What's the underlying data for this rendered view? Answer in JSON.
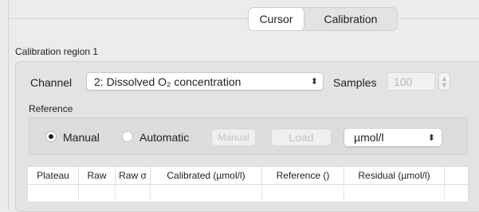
{
  "tabs": [
    {
      "label": "Cursor",
      "selected": true
    },
    {
      "label": "Calibration",
      "selected": false
    }
  ],
  "region": {
    "title": "Calibration region 1"
  },
  "channel": {
    "label": "Channel",
    "value": "2: Dissolved O₂ concentration"
  },
  "samples": {
    "label": "Samples",
    "value": "100"
  },
  "reference": {
    "title": "Reference",
    "modes": [
      {
        "label": "Manual",
        "checked": true
      },
      {
        "label": "Automatic",
        "checked": false
      }
    ],
    "manual_button": "Manual",
    "load_button": "Load",
    "unit": "µmol/l"
  },
  "table": {
    "columns": [
      "Plateau",
      "Raw",
      "Raw σ",
      "Calibrated (µmol/l)",
      "Reference ()",
      "Residual (µmol/l)",
      ""
    ]
  },
  "icons": {
    "popup": "up-down-chevron-icon",
    "stepper": "stepper-icon"
  }
}
